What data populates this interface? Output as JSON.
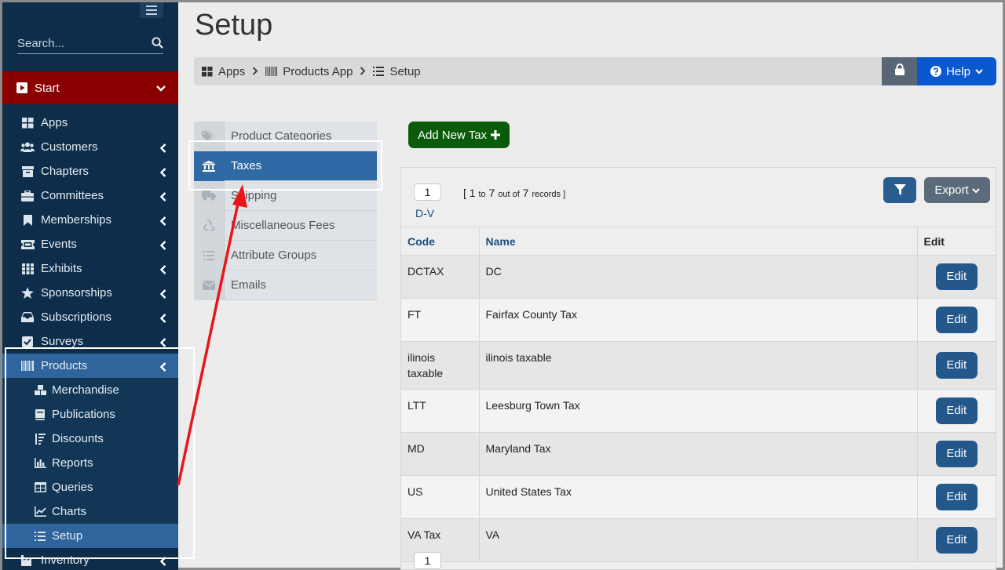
{
  "page": {
    "title": "Setup"
  },
  "sidebar": {
    "search_placeholder": "Search...",
    "start_label": "Start",
    "items": [
      {
        "label": "Apps",
        "icon": "grid-icon",
        "has_arrow": false
      },
      {
        "label": "Customers",
        "icon": "users-icon",
        "has_arrow": true
      },
      {
        "label": "Chapters",
        "icon": "archive-icon",
        "has_arrow": true
      },
      {
        "label": "Committees",
        "icon": "briefcase-icon",
        "has_arrow": true
      },
      {
        "label": "Memberships",
        "icon": "bookmark-icon",
        "has_arrow": true
      },
      {
        "label": "Events",
        "icon": "ticket-icon",
        "has_arrow": true
      },
      {
        "label": "Exhibits",
        "icon": "th-icon",
        "has_arrow": true
      },
      {
        "label": "Sponsorships",
        "icon": "star-icon",
        "has_arrow": true
      },
      {
        "label": "Subscriptions",
        "icon": "inbox-icon",
        "has_arrow": true
      },
      {
        "label": "Surveys",
        "icon": "check-square-icon",
        "has_arrow": true
      },
      {
        "label": "Products",
        "icon": "barcode-icon",
        "has_arrow": true
      }
    ],
    "products_sub": [
      {
        "label": "Merchandise",
        "icon": "cubes-icon"
      },
      {
        "label": "Publications",
        "icon": "book-icon"
      },
      {
        "label": "Discounts",
        "icon": "sort-icon"
      },
      {
        "label": "Reports",
        "icon": "bar-chart-icon"
      },
      {
        "label": "Queries",
        "icon": "table-icon"
      },
      {
        "label": "Charts",
        "icon": "line-chart-icon"
      },
      {
        "label": "Setup",
        "icon": "list-icon"
      }
    ],
    "after": {
      "label": "Inventory",
      "icon": "industry-icon"
    }
  },
  "breadcrumb": {
    "apps": "Apps",
    "products_app": "Products App",
    "setup": "Setup",
    "help_label": "Help"
  },
  "setup_menu": [
    {
      "label": "Product Categories",
      "icon": "tags-icon"
    },
    {
      "label": "Taxes",
      "icon": "bank-icon"
    },
    {
      "label": "Shipping",
      "icon": "truck-icon"
    },
    {
      "label": "Miscellaneous Fees",
      "icon": "recycle-icon"
    },
    {
      "label": "Attribute Groups",
      "icon": "list-icon"
    },
    {
      "label": "Emails",
      "icon": "envelope-icon"
    }
  ],
  "add_button_label": "Add New Tax",
  "grid": {
    "page": "1",
    "records_open": "[ 1",
    "records_to": "to",
    "records_mid": "7",
    "records_out": "out of",
    "records_total": "7",
    "records_word": "records ]",
    "dv_label": "D-V",
    "export_label": "Export",
    "columns": {
      "code": "Code",
      "name": "Name",
      "edit": "Edit"
    },
    "rows": [
      {
        "code": "DCTAX",
        "name": "DC",
        "edit": "Edit"
      },
      {
        "code": "FT",
        "name": "Fairfax County Tax",
        "edit": "Edit"
      },
      {
        "code": "ilinois taxable",
        "name": "ilinois taxable",
        "edit": "Edit"
      },
      {
        "code": "LTT",
        "name": "Leesburg Town Tax",
        "edit": "Edit"
      },
      {
        "code": "MD",
        "name": "Maryland Tax",
        "edit": "Edit"
      },
      {
        "code": "US",
        "name": "United States Tax",
        "edit": "Edit"
      },
      {
        "code": "VA Tax",
        "name": "VA",
        "edit": "Edit"
      }
    ],
    "bottom_page": "1"
  },
  "colors": {
    "sidebar_bg": "#0d2d4a",
    "start_bg": "#8a0000",
    "active_blue": "#2f659c",
    "help_blue": "#0a58d0",
    "add_green": "#0a5c0a",
    "annotation_red": "#e8161b"
  }
}
